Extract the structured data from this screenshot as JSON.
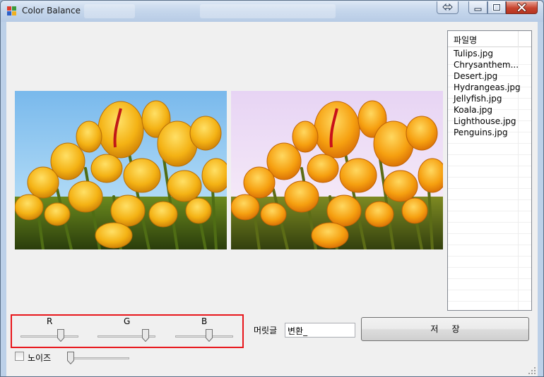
{
  "window": {
    "title": "Color Balance",
    "background_taskbar_labels": [
      "",
      ""
    ]
  },
  "title_buttons": {
    "pin_icon": "double-arrow-icon",
    "minimize_icon": "minimize-icon",
    "maximize_icon": "maximize-icon",
    "close_icon": "close-icon"
  },
  "file_list": {
    "column_header": "파일명",
    "items": [
      "Tulips.jpg",
      "Chrysanthem...",
      "Desert.jpg",
      "Hydrangeas.jpg",
      "Jellyfish.jpg",
      "Koala.jpg",
      "Lighthouse.jpg",
      "Penguins.jpg"
    ]
  },
  "sliders": {
    "r_label": "R",
    "g_label": "G",
    "b_label": "B",
    "r_value": 0.72,
    "g_value": 0.88,
    "b_value": 0.6,
    "noise_value": 0.0
  },
  "controls": {
    "noise_label": "노이즈",
    "noise_checked": false,
    "head_label": "머릿글",
    "head_value": "변환_",
    "save_label": "저     장"
  },
  "colors": {
    "highlight_border": "#e8161b",
    "title_close": "#c7442f"
  }
}
